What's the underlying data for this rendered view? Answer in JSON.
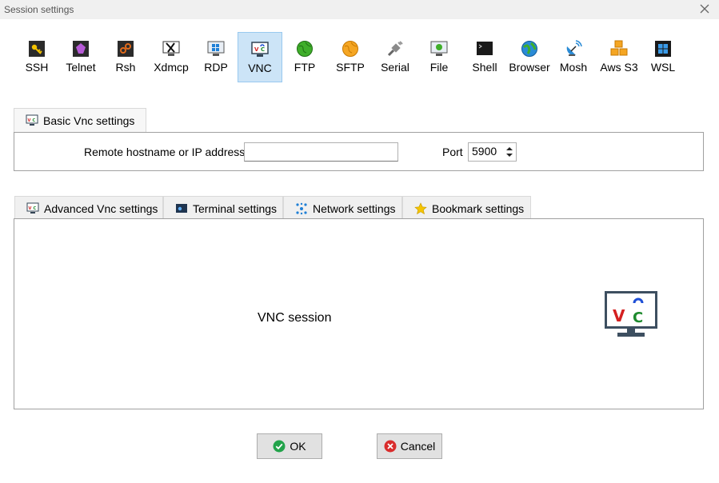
{
  "window": {
    "title": "Session settings"
  },
  "protocols": [
    {
      "label": "SSH",
      "icon": "ssh-key-icon",
      "selected": false
    },
    {
      "label": "Telnet",
      "icon": "telnet-icon",
      "selected": false
    },
    {
      "label": "Rsh",
      "icon": "rsh-icon",
      "selected": false
    },
    {
      "label": "Xdmcp",
      "icon": "xdmcp-icon",
      "selected": false
    },
    {
      "label": "RDP",
      "icon": "rdp-icon",
      "selected": false
    },
    {
      "label": "VNC",
      "icon": "vnc-icon",
      "selected": true
    },
    {
      "label": "FTP",
      "icon": "ftp-globe-icon",
      "selected": false
    },
    {
      "label": "SFTP",
      "icon": "sftp-globe-icon",
      "selected": false
    },
    {
      "label": "Serial",
      "icon": "serial-plug-icon",
      "selected": false
    },
    {
      "label": "File",
      "icon": "file-monitor-icon",
      "selected": false
    },
    {
      "label": "Shell",
      "icon": "shell-terminal-icon",
      "selected": false
    },
    {
      "label": "Browser",
      "icon": "browser-globe-icon",
      "selected": false
    },
    {
      "label": "Mosh",
      "icon": "mosh-satellite-icon",
      "selected": false
    },
    {
      "label": "Aws S3",
      "icon": "aws-s3-cubes-icon",
      "selected": false
    },
    {
      "label": "WSL",
      "icon": "wsl-windows-icon",
      "selected": false
    }
  ],
  "basic": {
    "tab_label": "Basic Vnc settings",
    "hostname_label": "Remote hostname or IP address *",
    "hostname_value": "",
    "port_label": "Port",
    "port_value": "5900"
  },
  "lower_tabs": [
    {
      "label": "Advanced Vnc settings",
      "icon": "vnc-monitor-icon"
    },
    {
      "label": "Terminal settings",
      "icon": "terminal-icon"
    },
    {
      "label": "Network settings",
      "icon": "network-icon"
    },
    {
      "label": "Bookmark settings",
      "icon": "star-icon"
    }
  ],
  "session": {
    "text": "VNC session",
    "logo_icon": "vnc-logo-icon"
  },
  "buttons": {
    "ok": "OK",
    "cancel": "Cancel"
  },
  "colors": {
    "selected_bg": "#cce4f7",
    "selected_border": "#99c9ef",
    "ok_green": "#22a34a",
    "cancel_red": "#d92c2c"
  }
}
